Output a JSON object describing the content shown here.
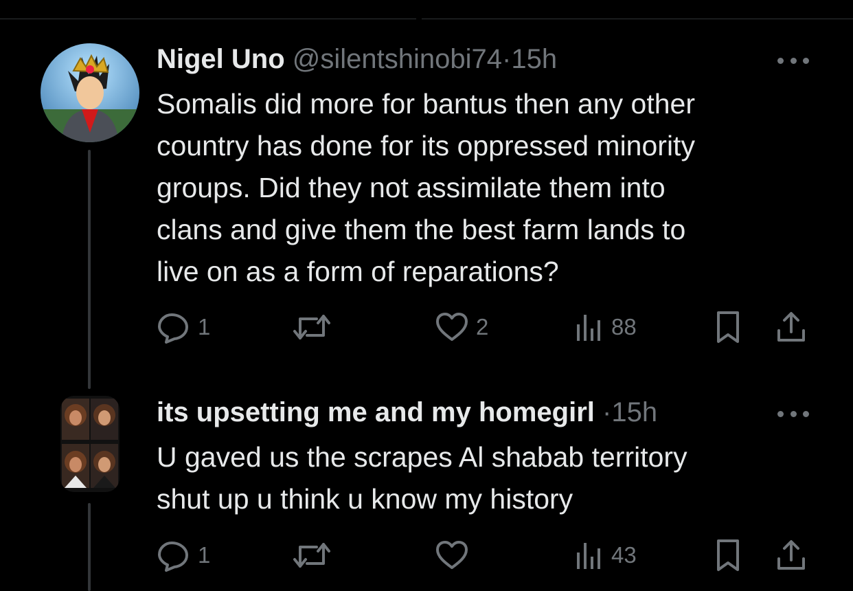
{
  "tweets": [
    {
      "display_name": "Nigel Uno",
      "handle": "@silentshinobi74",
      "separator": "·",
      "time": "15h",
      "text_lines": [
        "Somalis did more for bantus then any other",
        "country has done for its oppressed minority",
        "groups. Did they not assimilate them into",
        "clans and give them the best farm lands to",
        "live on as a form of reparations?"
      ],
      "actions": {
        "replies": "1",
        "retweets": "",
        "likes": "2",
        "views": "88"
      },
      "icons": {
        "reply": "reply-icon",
        "retweet": "retweet-icon",
        "like": "heart-icon",
        "views": "views-icon",
        "bookmark": "bookmark-icon",
        "share": "share-icon"
      }
    },
    {
      "display_name": "its upsetting me and my homegirl",
      "handle": "",
      "separator": "·",
      "time": "15h",
      "text_lines": [
        "U gaved us the scrapes Al shabab territory",
        "shut up u think u know my history"
      ],
      "actions": {
        "replies": "1",
        "retweets": "",
        "likes": "",
        "views": "43"
      },
      "icons": {
        "reply": "reply-icon",
        "retweet": "retweet-icon",
        "like": "heart-icon",
        "views": "views-icon",
        "bookmark": "bookmark-icon",
        "share": "share-icon"
      }
    }
  ],
  "colors": {
    "background": "#000000",
    "text": "#e7e9ea",
    "muted": "#71767b",
    "divider": "#2f3336"
  }
}
